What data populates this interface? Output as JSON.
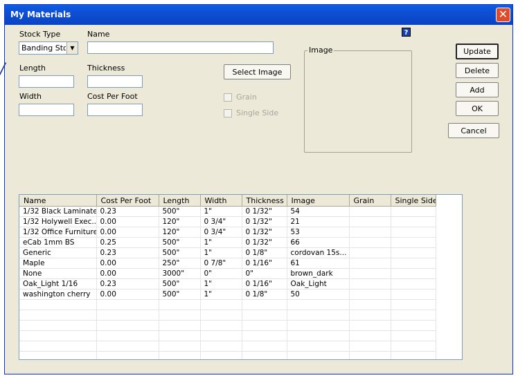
{
  "window": {
    "title": "My Materials",
    "close_glyph": "✕"
  },
  "form": {
    "stock_type": {
      "label": "Stock Type",
      "value": "Banding Stoc",
      "arrow": "▼"
    },
    "name": {
      "label": "Name",
      "value": ""
    },
    "length": {
      "label": "Length",
      "value": ""
    },
    "thickness": {
      "label": "Thickness",
      "value": ""
    },
    "width": {
      "label": "Width",
      "value": ""
    },
    "cost_per_foot": {
      "label": "Cost Per Foot",
      "value": ""
    },
    "select_image_label": "Select Image",
    "grain_label": "Grain",
    "single_side_label": "Single Side",
    "image_group_label": "Image",
    "help_glyph": "?"
  },
  "buttons": {
    "update": "Update",
    "delete": "Delete",
    "add": "Add",
    "ok": "OK",
    "cancel": "Cancel"
  },
  "table": {
    "columns": [
      "Name",
      "Cost Per Foot",
      "Length",
      "Width",
      "Thickness",
      "Image",
      "Grain",
      "Single Side"
    ],
    "rows": [
      [
        "1/32 Black Laminate",
        "0.23",
        "500\"",
        "1\"",
        "0 1/32\"",
        "54",
        "",
        ""
      ],
      [
        "1/32 Holywell Exec...",
        "0.00",
        "120\"",
        "0 3/4\"",
        "0 1/32\"",
        "21",
        "",
        ""
      ],
      [
        "1/32 Office Furniture",
        "0.00",
        "120\"",
        "0 3/4\"",
        "0 1/32\"",
        "53",
        "",
        ""
      ],
      [
        "eCab 1mm BS",
        "0.25",
        "500\"",
        "1\"",
        "0 1/32\"",
        "66",
        "",
        ""
      ],
      [
        "Generic",
        "0.23",
        "500\"",
        "1\"",
        "0 1/8\"",
        "cordovan 15s...",
        "",
        ""
      ],
      [
        "Maple",
        "0.00",
        "250\"",
        "0 7/8\"",
        "0 1/16\"",
        "61",
        "",
        ""
      ],
      [
        "None",
        "0.00",
        "3000\"",
        "0\"",
        "0\"",
        "brown_dark",
        "",
        ""
      ],
      [
        "Oak_Light 1/16",
        "0.23",
        "500\"",
        "1\"",
        "0 1/16\"",
        "Oak_Light",
        "",
        ""
      ],
      [
        "washington cherry",
        "0.00",
        "500\"",
        "1\"",
        "0 1/8\"",
        "50",
        "",
        ""
      ]
    ],
    "empty_rows": 7
  },
  "colors": {
    "titlebar": "#0a5ee4",
    "face": "#ece9d8",
    "border": "#7f9db9"
  },
  "icons": {
    "close": "close-icon",
    "help": "help-icon",
    "dropdown": "chevron-down-icon"
  }
}
